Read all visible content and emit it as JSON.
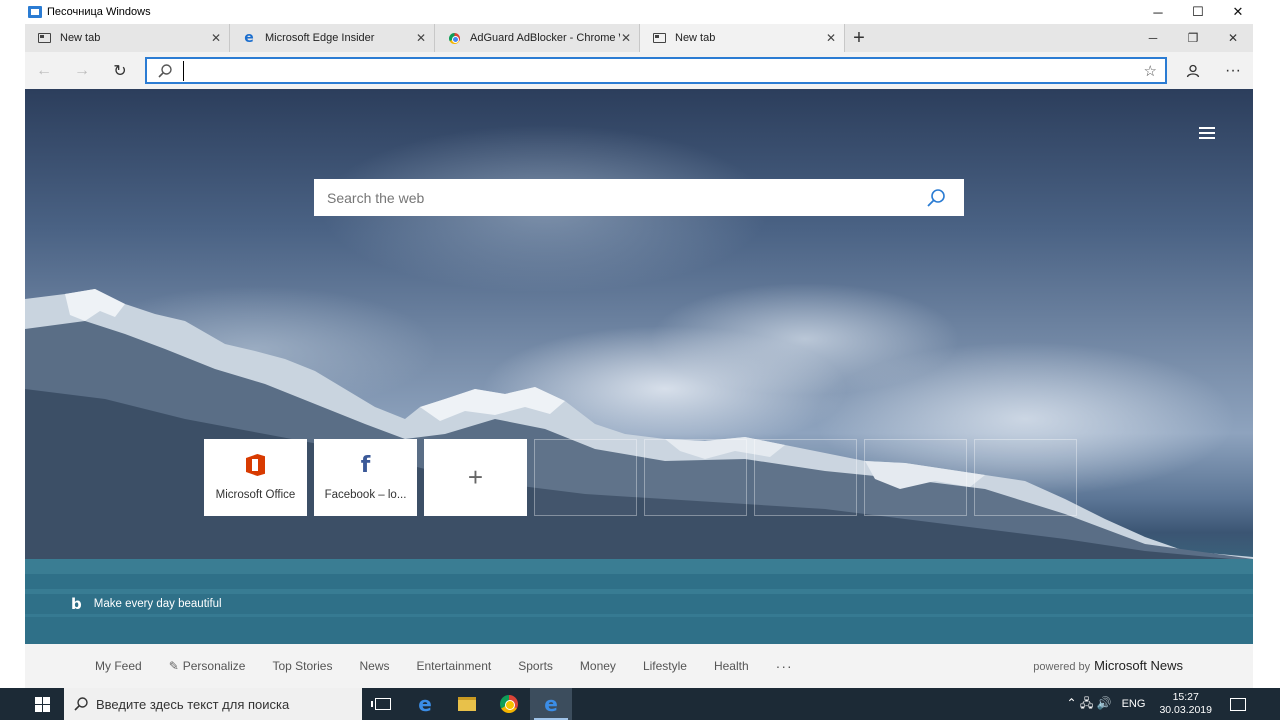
{
  "sandbox": {
    "title": "Песочница Windows",
    "controls": {
      "minimize": "─",
      "maximize": "☐",
      "close": "✕"
    }
  },
  "tabs": [
    {
      "label": "New tab",
      "icon": "page-icon",
      "active": false
    },
    {
      "label": "Microsoft Edge Insider",
      "icon": "edge-icon",
      "active": false
    },
    {
      "label": "AdGuard AdBlocker - Chrome Web Store",
      "icon": "chrome-icon",
      "active": false
    },
    {
      "label": "New tab",
      "icon": "page-icon",
      "active": true
    }
  ],
  "tabstrip": {
    "close_glyph": "✕",
    "new_tab_glyph": "+",
    "minimize": "─",
    "restore": "❐",
    "close": "✕"
  },
  "nav": {
    "back": "←",
    "forward": "→",
    "refresh": "↻",
    "address_value": "",
    "favorite": "☆",
    "profile": "👤",
    "menu": "···"
  },
  "newtab": {
    "search_placeholder": "Search the web",
    "tiles": [
      {
        "label": "Microsoft Office",
        "icon": "office-icon"
      },
      {
        "label": "Facebook – lo...",
        "icon": "facebook-icon"
      },
      {
        "label": "",
        "icon": "plus-icon"
      }
    ],
    "bing_caption": "Make every day beautiful",
    "bing_glyph": "b"
  },
  "newsbar": {
    "items": [
      "My Feed",
      "Personalize",
      "Top Stories",
      "News",
      "Entertainment",
      "Sports",
      "Money",
      "Lifestyle",
      "Health"
    ],
    "more": "···",
    "powered_prefix": "powered by",
    "powered_brand": "Microsoft News"
  },
  "taskbar": {
    "search_placeholder": "Введите здесь текст для поиска",
    "language": "ENG",
    "time": "15:27",
    "date": "30.03.2019",
    "tray_glyphs": "⌃ 🖧 🔊"
  },
  "colors": {
    "accent": "#2b7cd3",
    "taskbar": "#1c2a36",
    "office": "#d83b01",
    "facebook": "#3b5998"
  }
}
